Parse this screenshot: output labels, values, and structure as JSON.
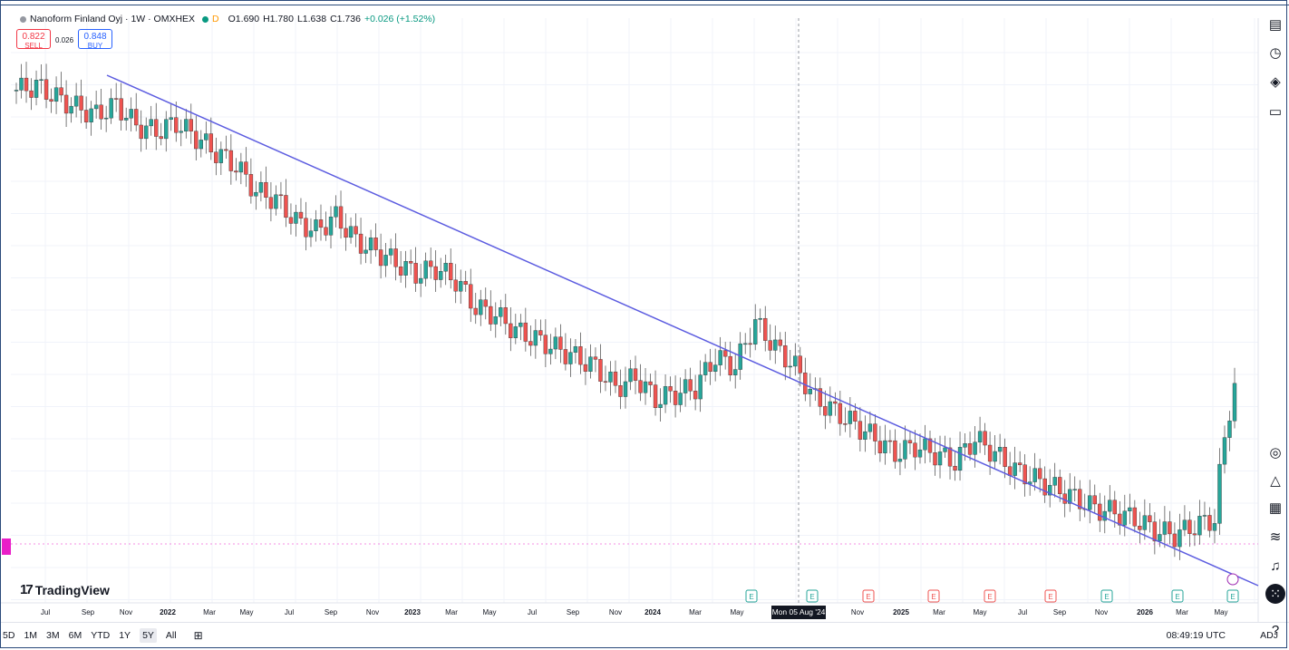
{
  "legend": {
    "symbol": "Nanoform Finland Oyj · 1W · OMXHEX",
    "market_flag": "D",
    "open": "O1.690",
    "high": "H1.780",
    "low": "L1.638",
    "close": "C1.736",
    "change": "+0.026 (+1.52%)"
  },
  "trade": {
    "sell_price": "0.822",
    "sell_label": "SELL",
    "spread": "0.026",
    "buy_price": "0.848",
    "buy_label": "BUY"
  },
  "brand": "TradingView",
  "crosshair_date": "Mon 05 Aug '24",
  "bottom": {
    "ranges": [
      "5D",
      "1M",
      "3M",
      "6M",
      "YTD",
      "1Y",
      "5Y",
      "All"
    ],
    "active_range": "5Y",
    "clock": "08:49:19 UTC",
    "adj": "ADJ"
  },
  "right_toolbar_icons": [
    "watchlist-icon",
    "alert-clock-icon",
    "layers-icon",
    "chat-icon",
    "target-icon",
    "triangle-icon",
    "calendar-icon",
    "broadcast-icon",
    "bell-icon",
    "grid-icon",
    "help-icon"
  ],
  "colors": {
    "up": "#26a69a",
    "down": "#ef5350",
    "trendline": "#5c5ce0",
    "earnings_green": "#26a69a",
    "earnings_red": "#ef5350"
  },
  "chart_data": {
    "type": "candlestick",
    "x_tick_labels": [
      "Jul",
      "Sep",
      "Nov",
      "2022",
      "Mar",
      "May",
      "Jul",
      "Sep",
      "Nov",
      "2023",
      "Mar",
      "May",
      "Jul",
      "Sep",
      "Nov",
      "2024",
      "Mar",
      "May",
      "Sep",
      "Nov",
      "2025",
      "Mar",
      "May",
      "Jul",
      "Sep",
      "Nov",
      "2026",
      "Mar",
      "May"
    ],
    "close_series": [
      8.2,
      8.4,
      7.9,
      7.5,
      7.2,
      7.6,
      6.8,
      6.6,
      6.9,
      6.4,
      5.9,
      5.5,
      4.8,
      4.6,
      4.1,
      3.9,
      4.2,
      3.7,
      3.5,
      3.3,
      3.1,
      3.2,
      3.0,
      2.6,
      2.5,
      2.3,
      2.2,
      2.1,
      2.0,
      1.9,
      1.7,
      1.8,
      1.6,
      1.65,
      1.7,
      2.0,
      1.9,
      2.4,
      2.1,
      1.9,
      1.6,
      1.5,
      1.4,
      1.3,
      1.2,
      1.25,
      1.2,
      1.15,
      1.3,
      1.2,
      1.1,
      1.05,
      1.0,
      0.95,
      0.9,
      0.88,
      0.85,
      0.8,
      0.78,
      0.82,
      0.85,
      1.74
    ],
    "trendline": {
      "from_index": 6,
      "to_index": 61
    },
    "earnings_markers": [
      {
        "label": "E",
        "kind": "green"
      },
      {
        "label": "E",
        "kind": "green"
      },
      {
        "label": "E",
        "kind": "red"
      },
      {
        "label": "E",
        "kind": "red"
      },
      {
        "label": "E",
        "kind": "red"
      },
      {
        "label": "E",
        "kind": "red"
      },
      {
        "label": "E",
        "kind": "green"
      },
      {
        "label": "E",
        "kind": "green"
      },
      {
        "label": "E",
        "kind": "green"
      }
    ]
  }
}
